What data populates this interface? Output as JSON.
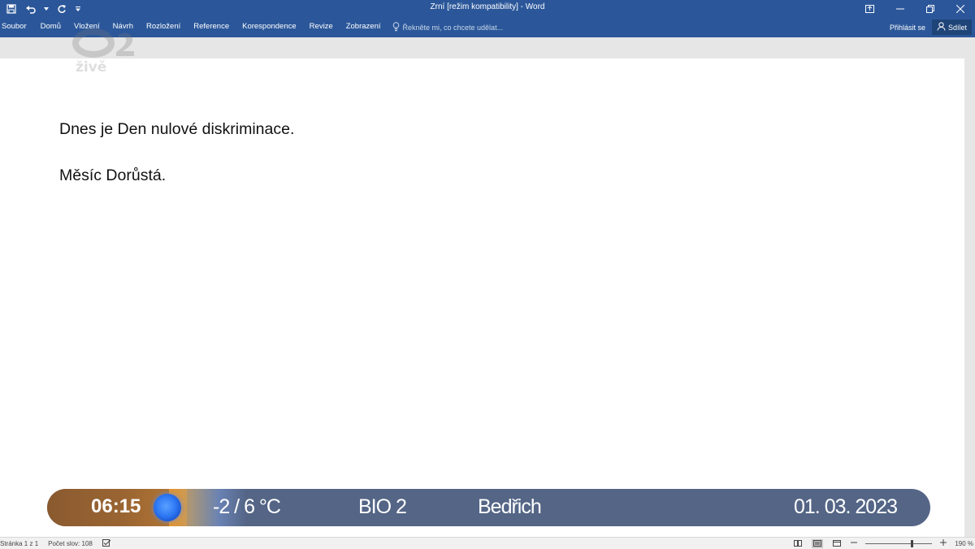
{
  "window": {
    "title": "Zrní [režim kompatibility] - Word"
  },
  "ribbon": {
    "tabs": [
      "Soubor",
      "Domů",
      "Vložení",
      "Návrh",
      "Rozložení",
      "Reference",
      "Korespondence",
      "Revize",
      "Zobrazení"
    ],
    "tell_me": "Řekněte mi, co chcete udělat...",
    "sign_in": "Přihlásit se",
    "share": "Sdílet"
  },
  "document": {
    "lines": [
      "Dnes je Den nulové diskriminace.",
      "Měsíc Dorůstá."
    ]
  },
  "watermark": {
    "text": "živě"
  },
  "status_bar": {
    "page": "Stránka 1 z 1",
    "word_count": "Počet slov: 108",
    "zoom": "190 %"
  },
  "ticker": {
    "time": "06:15",
    "temperature": "-2 / 6 °C",
    "channel": "BIO 2",
    "nameday": "Bedřich",
    "date": "01. 03. 2023"
  },
  "colors": {
    "title_bar": "#2b579a",
    "ticker_bar": "#546586",
    "ticker_time_block": "#9a6532"
  }
}
